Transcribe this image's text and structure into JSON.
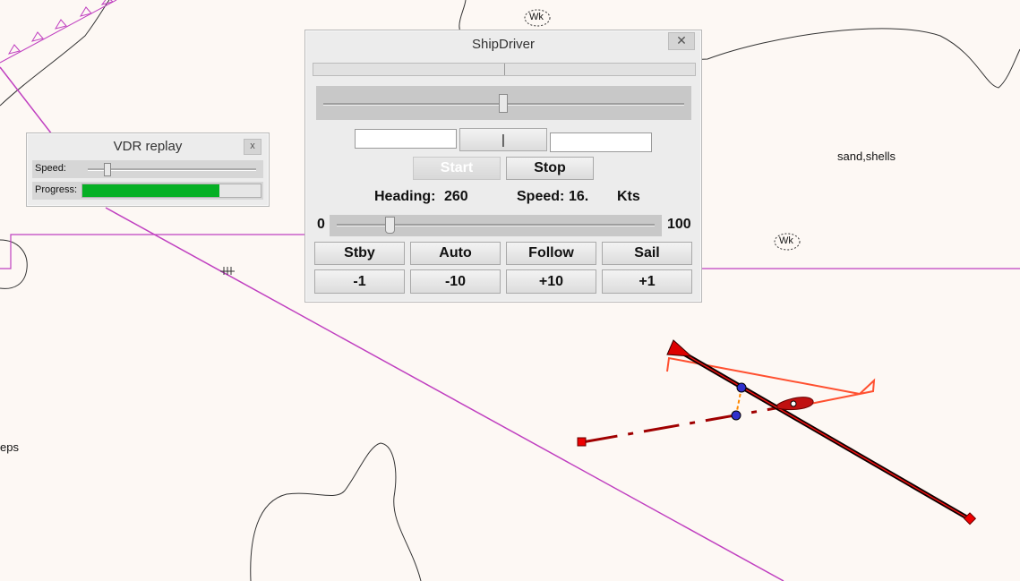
{
  "chart_labels": {
    "sand_shells": "sand,shells",
    "eps": "eps",
    "wk_1": "Wk",
    "wk_2": "Wk"
  },
  "vdr": {
    "title": "VDR replay",
    "close": "x",
    "speed_label": "Speed:",
    "progress_label": "Progress:",
    "progress_fraction": 0.77
  },
  "ship": {
    "title": "ShipDriver",
    "close": "✕",
    "rudder_button": "|",
    "left_field_value": "",
    "right_field_value": "",
    "start_label": "Start",
    "stop_label": "Stop",
    "heading_label": "Heading:",
    "heading_value": "260",
    "speed_label": "Speed:",
    "speed_value": "16.",
    "speed_unit": "Kts",
    "speed_min": "0",
    "speed_max": "100",
    "mode_buttons": [
      "Stby",
      "Auto",
      "Follow",
      "Sail"
    ],
    "step_buttons": [
      "-1",
      "-10",
      "+10",
      "+1"
    ]
  },
  "colors": {
    "route": "#c040c0",
    "track": "#ff5030",
    "vessel": "#cc0000",
    "heading_line": "#110000"
  }
}
